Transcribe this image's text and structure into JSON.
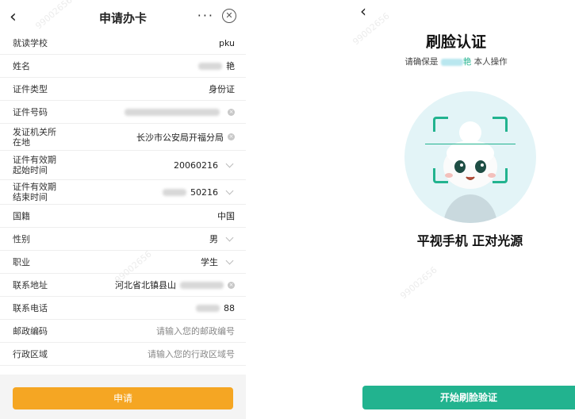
{
  "apply_screen": {
    "nav": {
      "back_icon": "‹",
      "title": "申请办卡",
      "more_icon": "···",
      "close_icon": "✕"
    },
    "fields": [
      {
        "label": "就读学校",
        "value": "pku",
        "kind": "text"
      },
      {
        "label": "姓名",
        "value": "艳",
        "kind": "masked"
      },
      {
        "label": "证件类型",
        "value": "身份证",
        "kind": "text"
      },
      {
        "label": "证件号码",
        "value": "",
        "kind": "masked-clear"
      },
      {
        "label": "发证机关所\n在地",
        "value": "长沙市公安局开福分局",
        "kind": "clear"
      },
      {
        "label": "证件有效期\n起始时间",
        "value": "20060216",
        "kind": "select"
      },
      {
        "label": "证件有效期\n结束时间",
        "value": "50216",
        "kind": "masked-select"
      },
      {
        "label": "国籍",
        "value": "中国",
        "kind": "text"
      },
      {
        "label": "性别",
        "value": "男",
        "kind": "select"
      },
      {
        "label": "职业",
        "value": "学生",
        "kind": "select"
      },
      {
        "label": "联系地址",
        "value": "河北省北镇县山",
        "kind": "masked-clear"
      },
      {
        "label": "联系电话",
        "value": "88",
        "kind": "masked"
      },
      {
        "label": "邮政编码",
        "value": "请输入您的邮政编号",
        "kind": "placeholder"
      },
      {
        "label": "行政区域",
        "value": "请输入您的行政区域号",
        "kind": "placeholder"
      }
    ],
    "apply_button": "申请",
    "accent_color": "#f5a623"
  },
  "face_verify_screen": {
    "back_icon": "‹",
    "title": "刷脸认证",
    "subtitle_prefix": "请确保是",
    "subtitle_name": "艳",
    "subtitle_suffix": "本人操作",
    "instruction": "平视手机 正对光源",
    "start_button": "开始刷脸验证",
    "accent_color": "#22b38f"
  },
  "watermark": "99002656"
}
